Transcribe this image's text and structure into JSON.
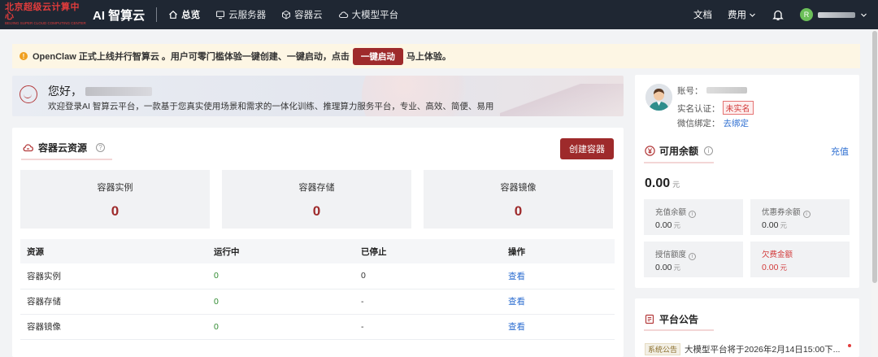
{
  "nav": {
    "logo_cn": "北京超级云计算中心",
    "logo_en": "BEIJING SUPER CLOUD COMPUTING CENTER",
    "brand": "AI 智算云",
    "items": [
      {
        "label": "总览",
        "icon": "home-icon",
        "active": true
      },
      {
        "label": "云服务器",
        "icon": "server-icon",
        "active": false
      },
      {
        "label": "容器云",
        "icon": "container-icon",
        "active": false
      },
      {
        "label": "大模型平台",
        "icon": "cloud-icon",
        "active": false
      }
    ],
    "docs": "文档",
    "billing": "费用",
    "user_initial": "R"
  },
  "notice": {
    "text_before": "OpenClaw 正式上线并行智算云 。用户可零门槛体验一键创建、一键启动，点击",
    "button": "一键启动",
    "text_after": "马上体验。"
  },
  "welcome": {
    "greeting": "您好，",
    "description": "欢迎登录AI 智算云平台，一款基于您真实使用场景和需求的一体化训练、推理算力服务平台，专业、高效、简便、易用"
  },
  "container": {
    "title": "容器云资源",
    "create_button": "创建容器",
    "stats": [
      {
        "label": "容器实例",
        "value": "0"
      },
      {
        "label": "容器存储",
        "value": "0"
      },
      {
        "label": "容器镜像",
        "value": "0"
      }
    ],
    "table": {
      "headers": [
        "资源",
        "运行中",
        "已停止",
        "操作"
      ],
      "rows": [
        {
          "name": "容器实例",
          "running": "0",
          "stopped": "0",
          "action": "查看"
        },
        {
          "name": "容器存储",
          "running": "0",
          "stopped": "-",
          "action": "查看"
        },
        {
          "name": "容器镜像",
          "running": "0",
          "stopped": "-",
          "action": "查看"
        }
      ]
    }
  },
  "account": {
    "account_label": "账号：",
    "realname_label": "实名认证：",
    "realname_status": "未实名",
    "wechat_label": "微信绑定：",
    "wechat_link": "去绑定"
  },
  "balance": {
    "title": "可用余额",
    "recharge": "充值",
    "amount": "0.00",
    "unit": "元",
    "cards": [
      {
        "label": "充值余额",
        "value": "0.00",
        "unit": "元",
        "info": true,
        "red": false
      },
      {
        "label": "优惠券余额",
        "value": "0.00",
        "unit": "元",
        "info": true,
        "red": false
      },
      {
        "label": "授信额度",
        "value": "0.00",
        "unit": "元",
        "info": true,
        "red": false
      },
      {
        "label": "欠费金额",
        "value": "0.00",
        "unit": "元",
        "info": false,
        "red": true
      }
    ]
  },
  "announcement": {
    "title": "平台公告",
    "tag": "系统公告",
    "text": "大模型平台将于2026年2月14日15:00下..."
  },
  "colors": {
    "nav_bg": "#1f2733",
    "brand_red": "#9e2a2b",
    "link_blue": "#2f6fd1",
    "running_green": "#2f8a2f"
  }
}
